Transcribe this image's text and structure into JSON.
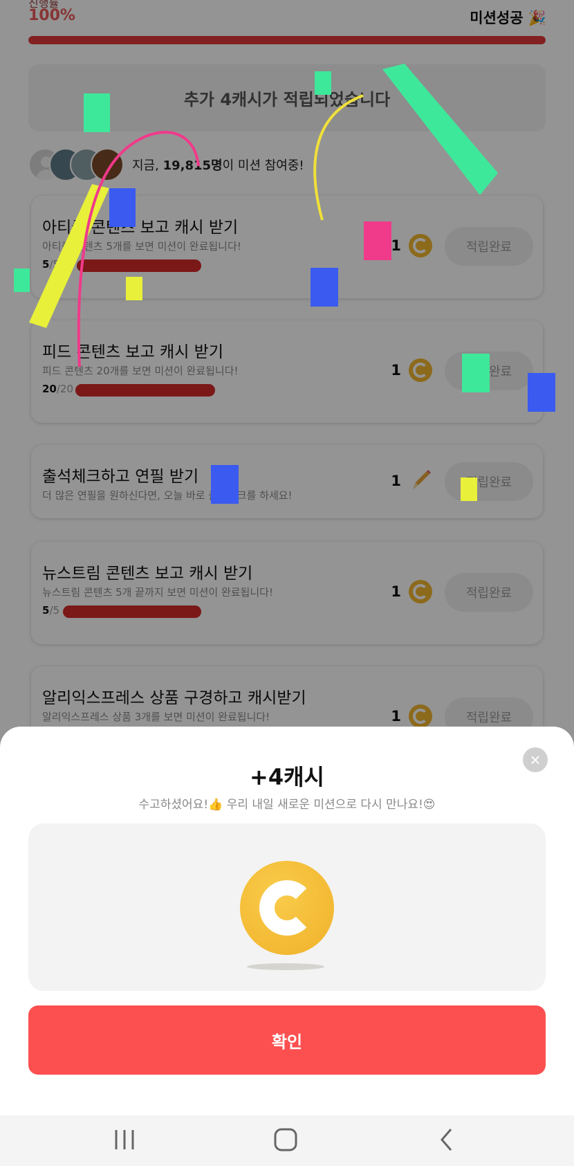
{
  "header": {
    "progress_label": "진행률",
    "progress_percent": "100%",
    "progress_value": 1.0,
    "mission_status": "미션성공 🎉"
  },
  "banner": {
    "text": "추가 4캐시가 적립되었습니다"
  },
  "participants": {
    "prefix": "지금, ",
    "count": "19,815명",
    "suffix": "이 미션 참여중!"
  },
  "missions": [
    {
      "title": "아티클 콘텐츠 보고 캐시 받기",
      "desc": "아티클 콘텐츠 5개를 보면 미션이 완료됩니다!",
      "done": "5",
      "total": "/5",
      "reward": "1",
      "reward_icon": "coin-icon",
      "button": "적립완료"
    },
    {
      "title": "피드 콘텐츠 보고 캐시 받기",
      "desc": "피드 콘텐츠 20개를 보면 미션이 완료됩니다!",
      "done": "20",
      "total": "/20",
      "reward": "1",
      "reward_icon": "coin-icon",
      "button": "적립완료"
    },
    {
      "title": "출석체크하고 연필 받기",
      "desc": "더 많은 연필을 원하신다면, 오늘 바로 출석체크를 하세요!",
      "reward": "1",
      "reward_icon": "pencil-icon",
      "button": "적립완료"
    },
    {
      "title": "뉴스트림 콘텐츠 보고 캐시 받기",
      "desc": "뉴스트림 콘텐츠 5개 끝까지 보면 미션이 완료됩니다!",
      "done": "5",
      "total": "/5",
      "reward": "1",
      "reward_icon": "coin-icon",
      "button": "적립완료"
    },
    {
      "title": "알리익스프레스 상품 구경하고 캐시받기",
      "desc": "알리익스프레스 상품 3개를 보면 미션이 완료됩니다!",
      "reward": "1",
      "reward_icon": "coin-icon",
      "button": "적립완료"
    }
  ],
  "sheet": {
    "title": "+4캐시",
    "subtitle": "수고하셨어요!👍 우리 내일 새로운 미션으로 다시 만나요!😍",
    "confirm_label": "확인",
    "close_icon": "close-icon",
    "coin_icon": "coin-icon"
  },
  "navbar": {
    "recent_icon": "recent-apps-icon",
    "home_icon": "home-icon",
    "back_icon": "back-icon"
  },
  "colors": {
    "accent": "#fc5050",
    "progress": "#e03a3a",
    "coin": "#f2b72f",
    "confetti": [
      "#3ee89a",
      "#e8f03a",
      "#3a5af0",
      "#f03a8a",
      "#f0e03a"
    ]
  }
}
